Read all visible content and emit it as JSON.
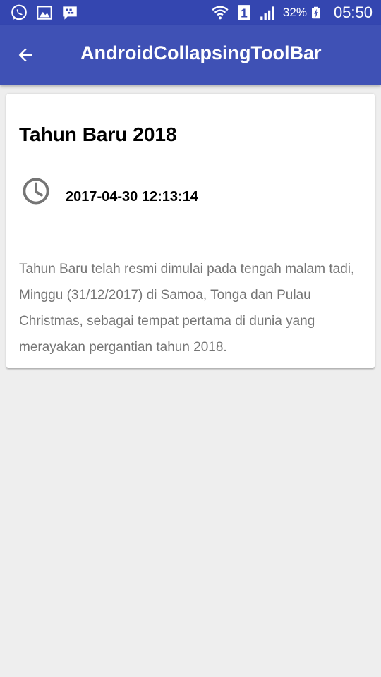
{
  "status_bar": {
    "battery_percent": "32%",
    "time": "05:50",
    "sim_slot": "1",
    "icons": [
      "whatsapp-icon",
      "gallery-icon",
      "bbm-icon",
      "wifi-icon",
      "sim-1-icon",
      "signal-icon",
      "battery-charging-icon"
    ]
  },
  "app_bar": {
    "title": "AndroidCollapsingToolBar",
    "back_icon": "arrow-back-icon",
    "color": "#3f51b5",
    "status_color": "#3446b0"
  },
  "card": {
    "title": "Tahun Baru 2018",
    "date_icon": "clock-icon",
    "date": "2017-04-30 12:13:14",
    "body": "Tahun Baru telah resmi dimulai pada tengah malam tadi, Minggu (31/12/2017) di Samoa, Tonga dan Pulau Christmas, sebagai tempat pertama di dunia yang merayakan pergantian tahun 2018."
  },
  "colors": {
    "background": "#eeeeee",
    "card": "#ffffff",
    "body_text": "#757575",
    "icon_gray": "#757575"
  }
}
